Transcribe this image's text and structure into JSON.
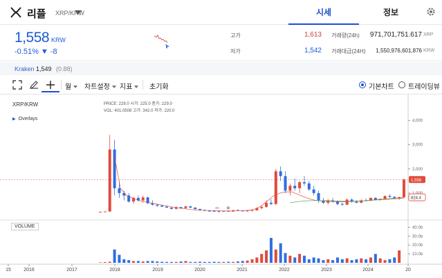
{
  "header": {
    "coin_name": "리플",
    "pair": "XRP/KRW",
    "tabs": [
      {
        "label": "시세"
      },
      {
        "label": "정보"
      }
    ]
  },
  "price": {
    "current": "1,558",
    "unit": "KRW",
    "change": "-0.51% ▼ -8"
  },
  "stats": {
    "high_label": "고가",
    "high_value": "1,613",
    "low_label": "저가",
    "low_value": "1,542",
    "vol_label": "거래량(24h)",
    "vol_value": "971,701,751.617",
    "vol_unit": "XRP",
    "amt_label": "거래대금(24H)",
    "amt_value": "1,550,976,601,876",
    "amt_unit": "KRW"
  },
  "exchange": {
    "name": "Kraken",
    "price": "1,549",
    "diff": "(0.88)"
  },
  "toolbar": {
    "period": "월",
    "chart_settings": "차트설정",
    "indicators": "지표",
    "reset": "초기화",
    "radio_basic": "기본차트",
    "radio_tv": "트레이딩뷰"
  },
  "chart": {
    "symbol": "XRP/KRW",
    "ohlc_line1": "PRICE: 229.0    시가: 225.0    종가: 229.0",
    "ohlc_line2": "VOL: 401.0508    고가: 342.0    저가: 220.0",
    "overlays": "Overlays",
    "volume_label": "VOLUME",
    "zoom_out": "−",
    "zoom_in": "+",
    "price_ticks": [
      "4,000",
      "3,000",
      "2,000",
      "1,558",
      "1,000"
    ],
    "volume_ticks": [
      "40.0b",
      "30.0b",
      "20.0b",
      "10.0b"
    ],
    "year_ticks": [
      "15",
      "2016",
      "2017",
      "2018",
      "2019",
      "2020",
      "2021",
      "2022",
      "2023",
      "2024",
      "20"
    ],
    "current_badge": "1,558",
    "ma_badge": "824.4"
  },
  "colors": {
    "accent": "#1a4fd0",
    "up": "#e04b3c",
    "down": "#2f6ee0",
    "ma1": "#e0463a",
    "ma2": "#4caf50"
  },
  "chart_data": {
    "type": "candlestick",
    "y_range": [
      0,
      4500
    ],
    "candles": [
      [
        202,
        230,
        200,
        225
      ],
      [
        225,
        250,
        215,
        240
      ],
      [
        240,
        3400,
        230,
        2800
      ],
      [
        2800,
        3200,
        900,
        1200
      ],
      [
        1200,
        1500,
        800,
        1000
      ],
      [
        1000,
        1100,
        700,
        900
      ],
      [
        900,
        1000,
        600,
        650
      ],
      [
        650,
        850,
        550,
        800
      ],
      [
        800,
        900,
        650,
        700
      ],
      [
        700,
        900,
        600,
        820
      ],
      [
        820,
        850,
        550,
        580
      ],
      [
        580,
        700,
        480,
        520
      ],
      [
        520,
        560,
        430,
        480
      ],
      [
        480,
        520,
        420,
        440
      ],
      [
        440,
        480,
        380,
        400
      ],
      [
        400,
        430,
        330,
        350
      ],
      [
        350,
        450,
        320,
        420
      ],
      [
        420,
        430,
        350,
        380
      ],
      [
        380,
        470,
        360,
        450
      ],
      [
        450,
        480,
        380,
        400
      ],
      [
        400,
        420,
        320,
        340
      ],
      [
        340,
        360,
        280,
        300
      ],
      [
        300,
        330,
        250,
        270
      ],
      [
        270,
        300,
        230,
        260
      ],
      [
        260,
        290,
        230,
        250
      ],
      [
        250,
        280,
        210,
        240
      ],
      [
        240,
        270,
        220,
        260
      ],
      [
        260,
        280,
        230,
        240
      ],
      [
        240,
        310,
        220,
        290
      ],
      [
        290,
        340,
        260,
        280
      ],
      [
        280,
        300,
        230,
        250
      ],
      [
        250,
        300,
        230,
        280
      ],
      [
        280,
        310,
        250,
        290
      ],
      [
        290,
        420,
        270,
        380
      ],
      [
        380,
        480,
        330,
        430
      ],
      [
        430,
        700,
        380,
        600
      ],
      [
        600,
        750,
        500,
        550
      ],
      [
        550,
        2000,
        500,
        1900
      ],
      [
        1900,
        2100,
        1500,
        1700
      ],
      [
        1700,
        1900,
        1000,
        1100
      ],
      [
        1100,
        1400,
        900,
        1300
      ],
      [
        1300,
        1600,
        1100,
        1200
      ],
      [
        1200,
        1500,
        1000,
        1450
      ],
      [
        1450,
        1700,
        1300,
        1400
      ],
      [
        1400,
        1500,
        1100,
        1150
      ],
      [
        1150,
        1300,
        900,
        1000
      ],
      [
        1000,
        1100,
        600,
        700
      ],
      [
        700,
        800,
        550,
        600
      ],
      [
        600,
        750,
        520,
        700
      ],
      [
        700,
        800,
        600,
        650
      ],
      [
        650,
        700,
        500,
        550
      ],
      [
        550,
        600,
        480,
        520
      ],
      [
        520,
        780,
        500,
        730
      ],
      [
        730,
        780,
        600,
        640
      ],
      [
        640,
        700,
        580,
        600
      ],
      [
        600,
        750,
        580,
        700
      ],
      [
        700,
        780,
        650,
        690
      ],
      [
        690,
        820,
        660,
        800
      ],
      [
        800,
        830,
        700,
        720
      ],
      [
        720,
        780,
        680,
        760
      ],
      [
        760,
        900,
        740,
        880
      ],
      [
        880,
        950,
        820,
        840
      ],
      [
        840,
        880,
        760,
        780
      ],
      [
        780,
        850,
        720,
        830
      ],
      [
        830,
        1600,
        800,
        1558
      ]
    ],
    "ma_red": [
      2500,
      1200,
      900,
      800,
      700,
      650,
      600,
      550,
      500,
      460,
      420,
      380,
      350,
      320,
      300,
      290,
      280,
      270,
      265,
      260,
      262,
      265,
      270,
      300,
      350,
      500,
      700,
      900,
      1000,
      1050,
      1050,
      950,
      850,
      760,
      700,
      680,
      660,
      650,
      640,
      640,
      650,
      660,
      680,
      700,
      720,
      740,
      760,
      780,
      800,
      824
    ],
    "ma_green": [
      600,
      650,
      680,
      690,
      690,
      680,
      670,
      665,
      670,
      680,
      700,
      720,
      740,
      760,
      790
    ],
    "volume_b": [
      0.5,
      0.8,
      1.2,
      15,
      9,
      4,
      3,
      2,
      2,
      1.5,
      2,
      2,
      1.5,
      1.2,
      1,
      1,
      1,
      1.5,
      2,
      1,
      1,
      1.2,
      1,
      1,
      1.2,
      1,
      1,
      1.2,
      1,
      1.5,
      2,
      2.5,
      4,
      6,
      10,
      14,
      28,
      15,
      22,
      11,
      8,
      6,
      10,
      8,
      4,
      6,
      5,
      3,
      4,
      3,
      6,
      4,
      5,
      3,
      4,
      5,
      4,
      6,
      10,
      5,
      3,
      4,
      6,
      14
    ]
  }
}
